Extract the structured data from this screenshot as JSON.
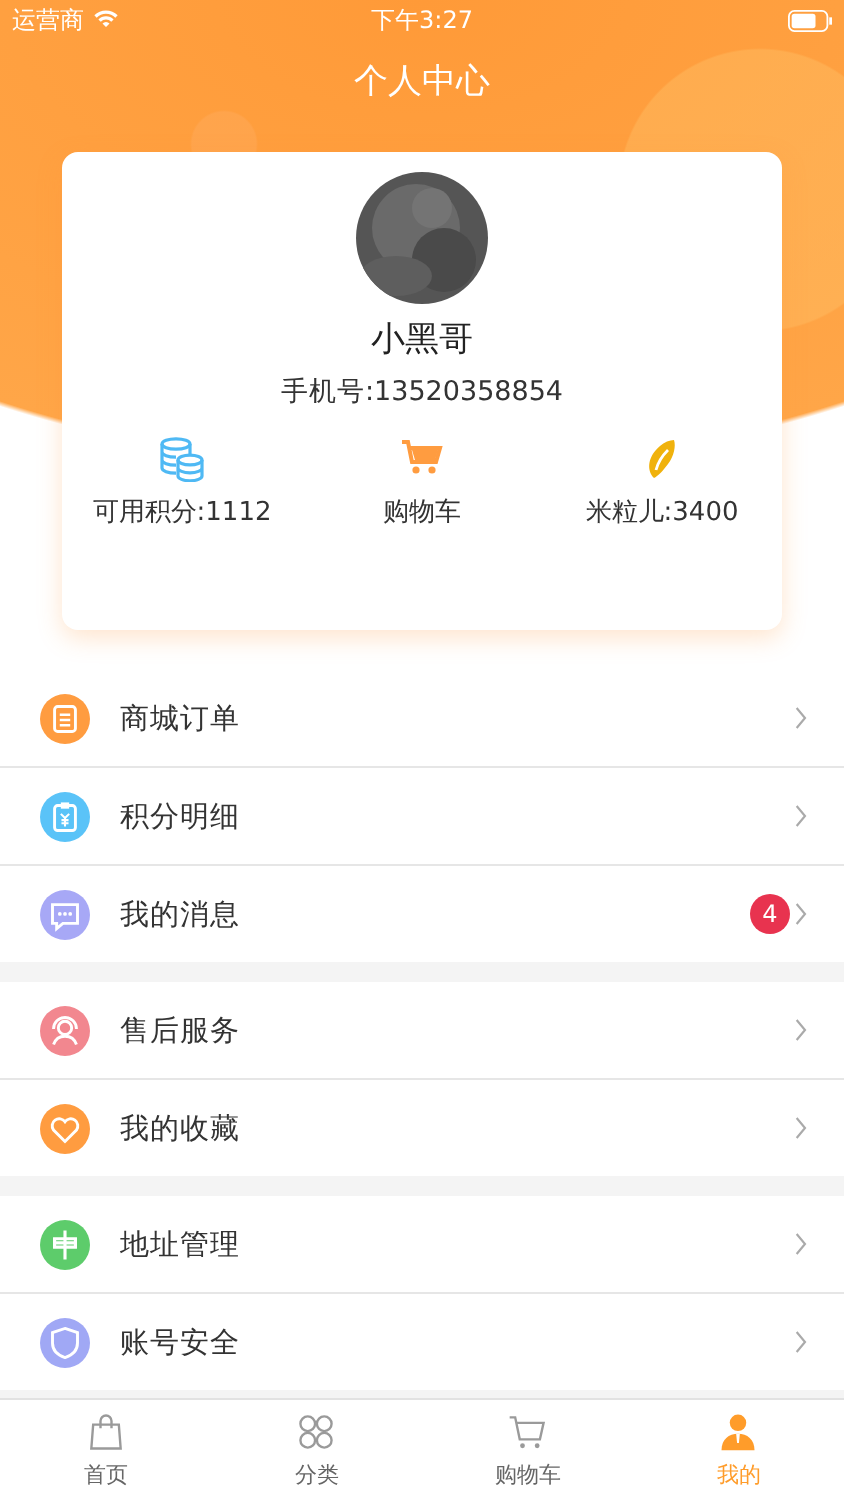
{
  "status_bar": {
    "carrier": "运营商",
    "time": "下午3:27"
  },
  "title": "个人中心",
  "profile": {
    "name": "小黑哥",
    "phone": "手机号:13520358854"
  },
  "stats": [
    {
      "kind": "coins",
      "label": "可用积分:1112"
    },
    {
      "kind": "cart",
      "label": "购物车"
    },
    {
      "kind": "grain",
      "label": "米粒儿:3400"
    }
  ],
  "menu_groups": [
    {
      "items": [
        {
          "kind": "order",
          "label": "商城订单",
          "color": "#ff9c40"
        },
        {
          "kind": "points",
          "label": "积分明细",
          "color": "#5ac3f8"
        },
        {
          "kind": "message",
          "label": "我的消息",
          "color": "#a7a8f6",
          "badge": "4"
        }
      ]
    },
    {
      "items": [
        {
          "kind": "service",
          "label": "售后服务",
          "color": "#f2878f"
        },
        {
          "kind": "favorite",
          "label": "我的收藏",
          "color": "#ff9c40"
        }
      ]
    },
    {
      "items": [
        {
          "kind": "address",
          "label": "地址管理",
          "color": "#5dcc6b"
        },
        {
          "kind": "security",
          "label": "账号安全",
          "color": "#a0a8f5"
        }
      ]
    }
  ],
  "tab_bar": [
    {
      "kind": "home",
      "label": "首页",
      "selected": false
    },
    {
      "kind": "category",
      "label": "分类",
      "selected": false
    },
    {
      "kind": "cart",
      "label": "购物车",
      "selected": false
    },
    {
      "kind": "me",
      "label": "我的",
      "selected": true
    }
  ]
}
